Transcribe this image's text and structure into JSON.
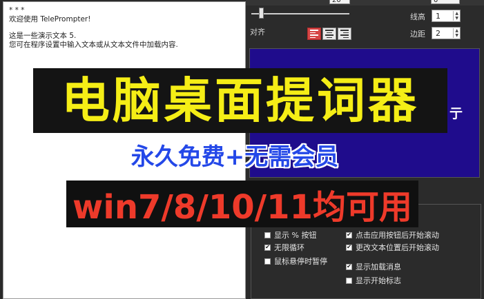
{
  "document": {
    "marker": "* * *",
    "welcome": "欢迎使用 TelePrompter!",
    "line1": "这是一些演示文本 5.",
    "line2": "您可在程序设置中输入文本或从文本文件中加载内容."
  },
  "settings": {
    "top_dropdown_value": "20",
    "align_label": "对齐",
    "line_height_label": "线高",
    "line_height_value": "1",
    "margin_label": "边距",
    "margin_value": "2",
    "top_spin_value": "0",
    "alignment_options": [
      "left",
      "center",
      "right"
    ],
    "alignment_selected": "left"
  },
  "preview": {
    "text_fragment": "亍"
  },
  "options": [
    {
      "label": "显示 % 按钮",
      "checked": false
    },
    {
      "label": "无限循环",
      "checked": true
    },
    {
      "label": "鼠标悬停时暂停",
      "checked": false
    },
    {
      "label": "点击应用按钮后开始滚动",
      "checked": true
    },
    {
      "label": "更改文本位置后开始滚动",
      "checked": true
    },
    {
      "label": "显示加载消息",
      "checked": true
    },
    {
      "label": "显示开始标志",
      "checked": false
    }
  ],
  "overlay": {
    "title": "电脑桌面提词器",
    "subtitle": "永久免费+无需会员",
    "platforms": "win7/8/10/11均可用"
  },
  "colors": {
    "preview_bg": "#1f0c8c",
    "title_yellow": "#f5ee16",
    "subtitle_blue": "#2448e8",
    "platform_red": "#ee3a2a",
    "active_align": "#d64545"
  }
}
